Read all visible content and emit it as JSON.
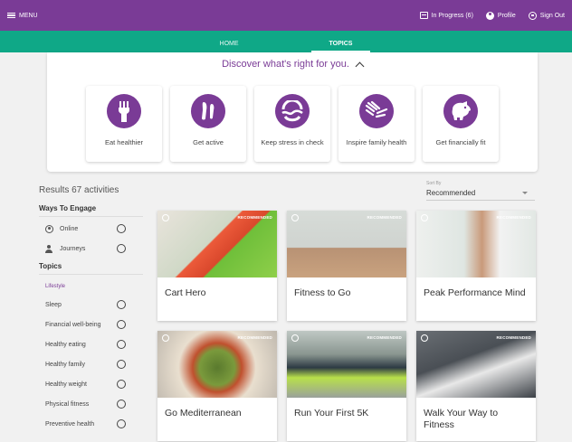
{
  "header": {
    "menu_label": "MENU",
    "in_progress_label": "In Progress (6)",
    "profile_label": "Profile",
    "signout_label": "Sign Out"
  },
  "nav": {
    "tabs": [
      {
        "label": "HOME"
      },
      {
        "label": "TOPICS"
      }
    ]
  },
  "discover": {
    "title": "Discover what's right for you.",
    "topics": [
      {
        "label": "Eat healthier",
        "icon": "fork-icon"
      },
      {
        "label": "Get active",
        "icon": "running-foot-icon"
      },
      {
        "label": "Keep stress in check",
        "icon": "stress-waves-icon"
      },
      {
        "label": "Inspire family health",
        "icon": "family-hands-icon"
      },
      {
        "label": "Get financially fit",
        "icon": "piggy-bank-icon"
      }
    ]
  },
  "results": {
    "count_label": "Results 67 activities"
  },
  "sort": {
    "label": "Sort By",
    "value": "Recommended"
  },
  "filters": {
    "engage_title": "Ways To Engage",
    "engage": [
      {
        "label": "Online",
        "icon": "globe-icon"
      },
      {
        "label": "Journeys",
        "icon": "people-icon"
      }
    ],
    "topics_title": "Topics",
    "lifestyle_label": "Lifestyle",
    "topics": [
      {
        "label": "Sleep"
      },
      {
        "label": "Financial well-being"
      },
      {
        "label": "Healthy eating"
      },
      {
        "label": "Healthy family"
      },
      {
        "label": "Healthy weight"
      },
      {
        "label": "Physical fitness"
      },
      {
        "label": "Preventive health"
      }
    ]
  },
  "activities": [
    {
      "title": "Cart Hero",
      "badge": "RECOMMENDED"
    },
    {
      "title": "Fitness to Go",
      "badge": "RECOMMENDED"
    },
    {
      "title": "Peak Performance Mind",
      "badge": "RECOMMENDED"
    },
    {
      "title": "Go Mediterranean",
      "badge": "RECOMMENDED"
    },
    {
      "title": "Run Your First 5K",
      "badge": "RECOMMENDED"
    },
    {
      "title": "Walk Your Way to Fitness",
      "badge": "RECOMMENDED"
    }
  ],
  "colors": {
    "brand_purple": "#7a3b96",
    "nav_green": "#0fa887"
  }
}
